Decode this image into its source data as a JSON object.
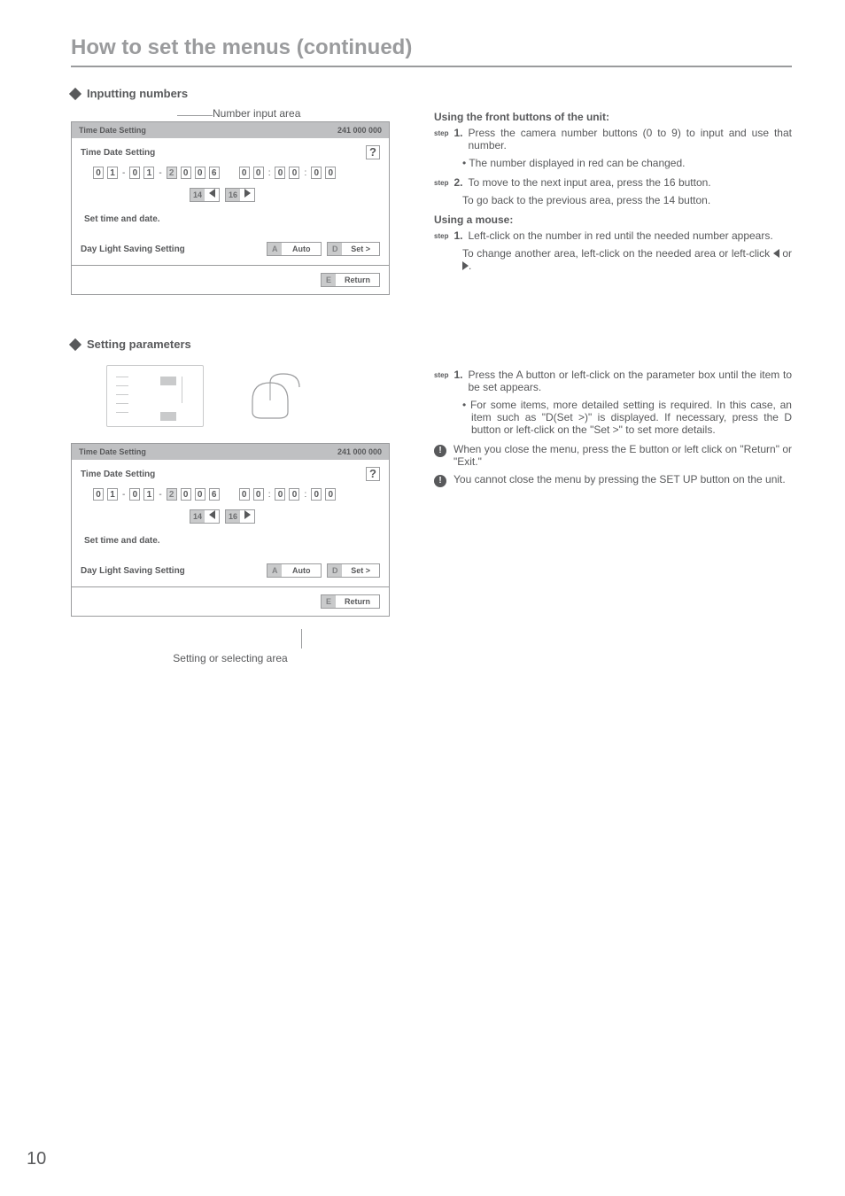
{
  "page": {
    "title": "How to set the menus (continued)",
    "number": "10"
  },
  "sections": {
    "inputting": "Inputting numbers",
    "setting_params": "Setting parameters"
  },
  "callouts": {
    "number_input_area": "Number input area",
    "setting_area": "Setting or selecting area"
  },
  "panel": {
    "header_title": "Time Date Setting",
    "header_code": "241 000 000",
    "subtitle": "Time Date Setting",
    "help": "?",
    "date_digits": [
      "0",
      "1",
      "-",
      "0",
      "1",
      "-",
      "2",
      "0",
      "0",
      "6"
    ],
    "time_digits": [
      "0",
      "0",
      ":",
      "0",
      "0",
      ":",
      "0",
      "0"
    ],
    "nav_prev": "14",
    "nav_next": "16",
    "instruction": "Set time and date.",
    "dls_label": "Day Light Saving Setting",
    "btn_a_letter": "A",
    "btn_a_val": "Auto",
    "btn_d_letter": "D",
    "btn_d_val": "Set >",
    "btn_e_letter": "E",
    "btn_e_val": "Return"
  },
  "right": {
    "front_buttons_title": "Using the front buttons of the unit:",
    "step1_label": "step",
    "step1_num": "1.",
    "step1_text": "Press the camera number buttons (0 to 9) to input and use that number.",
    "step1_bullet": "The number displayed in red can be changed.",
    "step2_num": "2.",
    "step2_text": "To move to the next input area, press the 16 button.",
    "step2_body": "To go back to the previous area, press the 14 button.",
    "mouse_title": "Using a mouse:",
    "mouse_step1_text": "Left-click on the number in red until the needed number appears.",
    "mouse_body": "To change another area, left-click on the needed area or left-click ",
    "mouse_body_suffix": " or ",
    "mouse_body_end": ".",
    "params_step1_text": "Press the A button or left-click on the parameter box until the item to be set appears.",
    "params_bullet": "For some items, more detailed setting is required. In this case, an item such as \"D(Set >)\" is displayed. If necessary, press the D button or left-click on the \"Set >\" to set more details.",
    "note1": "When you close the menu, press the E button or left click on \"Return\" or \"Exit.\"",
    "note2": "You cannot close the menu by pressing the SET UP button on the unit."
  }
}
